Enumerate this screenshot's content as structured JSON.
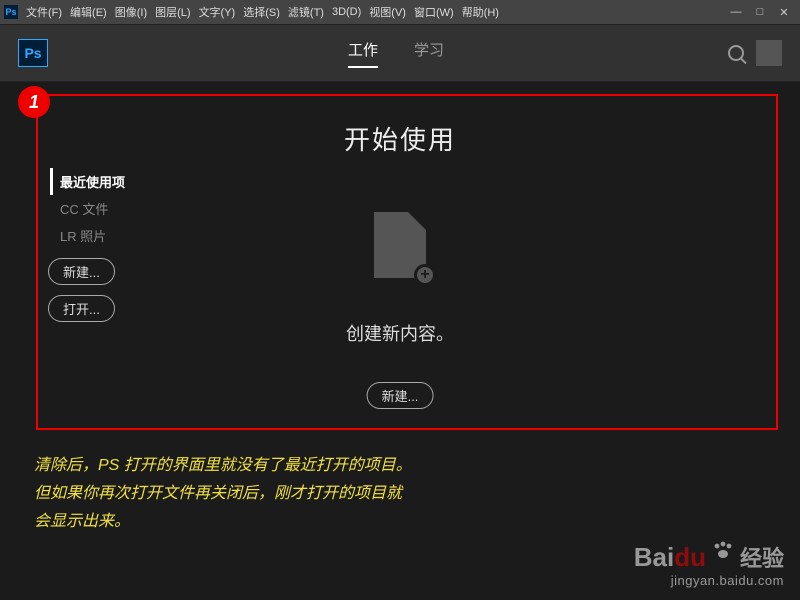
{
  "menubar": {
    "items": [
      "文件(F)",
      "编辑(E)",
      "图像(I)",
      "图层(L)",
      "文字(Y)",
      "选择(S)",
      "滤镜(T)",
      "3D(D)",
      "视图(V)",
      "窗口(W)",
      "帮助(H)"
    ]
  },
  "tabs": {
    "work": "工作",
    "learn": "学习"
  },
  "start": {
    "title": "开始使用",
    "create_label": "创建新内容。",
    "new_button": "新建..."
  },
  "sidebar": {
    "items": [
      "最近使用项",
      "CC 文件",
      "LR 照片"
    ],
    "new_btn": "新建...",
    "open_btn": "打开..."
  },
  "annotation": {
    "badge": "1",
    "line1": "清除后，PS 打开的界面里就没有了最近打开的项目。",
    "line2": "但如果你再次打开文件再关闭后，刚才打开的项目就",
    "line3": "会显示出来。"
  },
  "watermark": {
    "brand": "Bai",
    "du": "du",
    "jy": "经验",
    "url": "jingyan.baidu.com"
  }
}
